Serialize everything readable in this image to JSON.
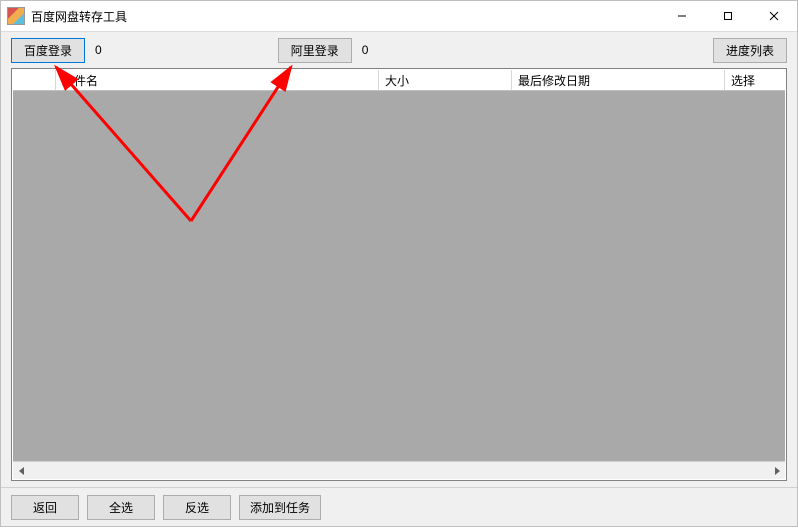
{
  "window": {
    "title": "百度网盘转存工具"
  },
  "toolbar": {
    "baidu_login_label": "百度登录",
    "baidu_count": "0",
    "ali_login_label": "阿里登录",
    "ali_count": "0",
    "progress_list_label": "进度列表"
  },
  "columns": {
    "c0": "",
    "c1": "文件名",
    "c2": "大小",
    "c3": "最后修改日期",
    "c4": "选择"
  },
  "bottom": {
    "back": "返回",
    "select_all": "全选",
    "invert": "反选",
    "add_task": "添加到任务"
  },
  "annotation": {
    "arrow_color": "#ff0000"
  }
}
